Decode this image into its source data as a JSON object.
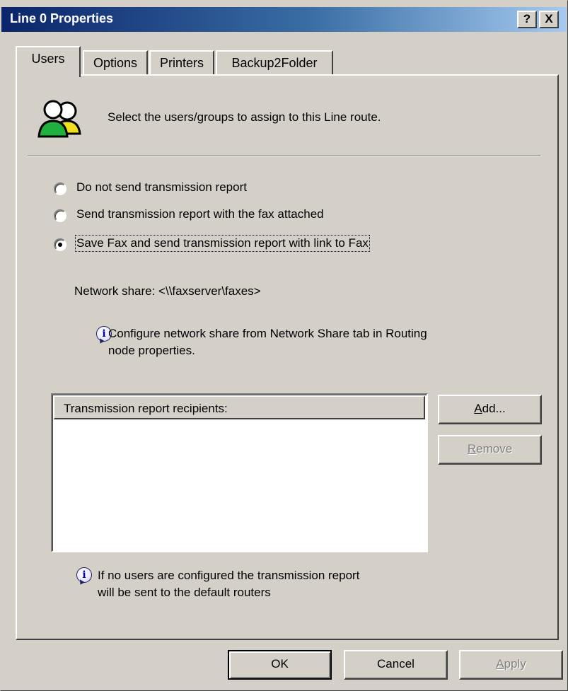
{
  "window": {
    "title": "Line 0 Properties",
    "help_glyph": "?",
    "close_glyph": "X"
  },
  "tabs": [
    {
      "label": "Users",
      "active": true
    },
    {
      "label": "Options",
      "active": false
    },
    {
      "label": "Printers",
      "active": false
    },
    {
      "label": "Backup2Folder",
      "active": false
    }
  ],
  "header": {
    "icon": "users-group-icon",
    "description": "Select the users/groups to assign to this Line route."
  },
  "report_options": [
    {
      "label": "Do not send transmission report",
      "selected": false
    },
    {
      "label": "Send transmission report with the fax attached",
      "selected": false
    },
    {
      "label": "Save Fax and send transmission report with link to Fax",
      "selected": true
    }
  ],
  "network_share": {
    "text": "Network share: <\\\\faxserver\\faxes>"
  },
  "share_note": {
    "icon": "info-icon",
    "line1": "Configure network share from Network Share tab in Routing",
    "line2": "node properties."
  },
  "recipients": {
    "column_header": "Transmission report recipients:",
    "items": []
  },
  "side_buttons": {
    "add": {
      "pre": "",
      "mnemonic": "A",
      "post": "dd...",
      "enabled": true
    },
    "remove": {
      "pre": "",
      "mnemonic": "R",
      "post": "emove",
      "enabled": false
    }
  },
  "footer_note": {
    "icon": "info-icon",
    "line1": "If no users are configured the transmission report",
    "line2": "will be sent to the default routers"
  },
  "dialog_buttons": {
    "ok": "OK",
    "cancel": "Cancel",
    "apply": {
      "pre": "",
      "mnemonic": "A",
      "post": "pply",
      "enabled": false
    }
  },
  "colors": {
    "titlebar_start": "#0a246a",
    "titlebar_end": "#a6caf0",
    "face": "#d4d0c8",
    "disabled_text": "#808080"
  }
}
